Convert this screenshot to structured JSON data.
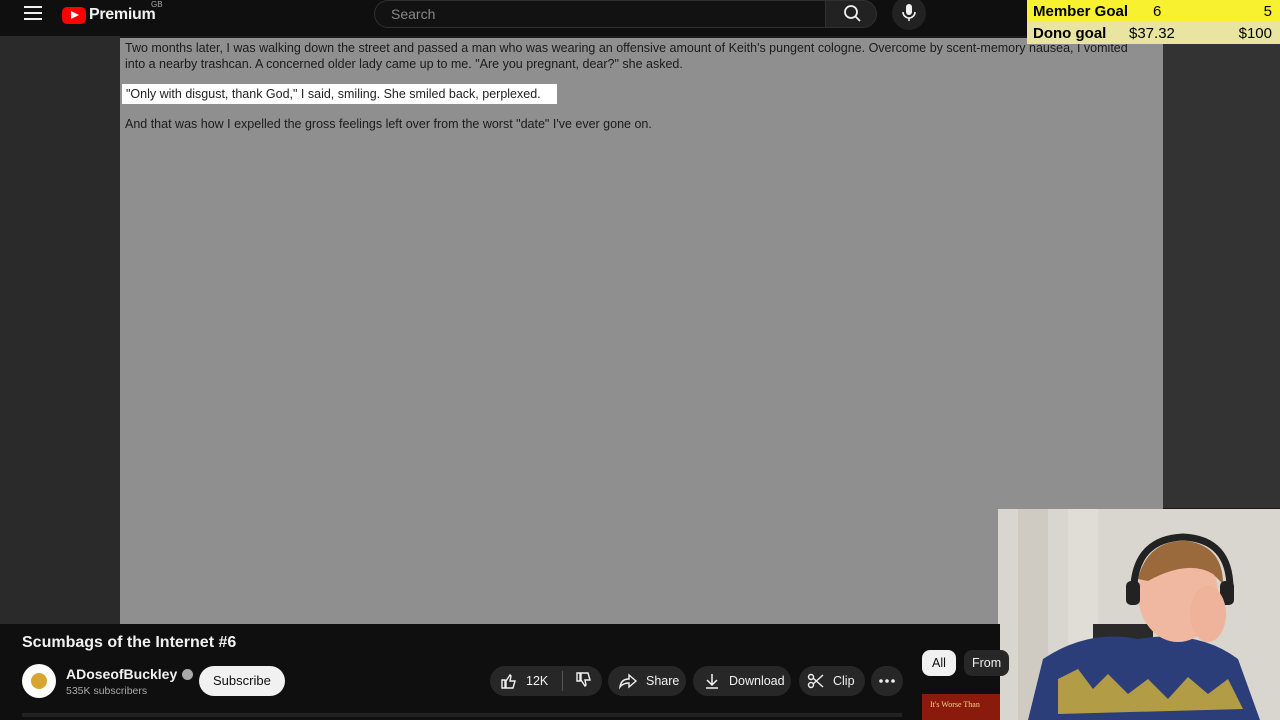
{
  "header": {
    "logo_text": "Premium",
    "country_code": "GB",
    "search_placeholder": "Search",
    "icons": [
      "menu-icon",
      "youtube-logo-icon",
      "search-icon",
      "mic-icon"
    ]
  },
  "stream_overlay": {
    "member_goal_label": "Member Goal",
    "member_goal_current": "6",
    "member_goal_target": "5",
    "dono_goal_label": "Dono goal",
    "dono_goal_current": "$37.32",
    "dono_goal_target": "$100",
    "colors": {
      "member": "#f7f130",
      "dono": "#ece9c4"
    }
  },
  "document": {
    "paragraph_1": "Two months later, I was walking down the street and passed a man who was wearing an offensive amount of Keith's pungent cologne. Overcome by scent-memory nausea, I vomited into a nearby trashcan. A concerned older lady came up to me. \"Are you pregnant, dear?\" she asked.",
    "paragraph_2": "\"Only with disgust, thank God,\" I said, smiling. She smiled back, perplexed.",
    "paragraph_3": "And that was how I expelled the gross feelings left over from the worst \"date\" I've ever gone on."
  },
  "video_info": {
    "title": "Scumbags of the Internet #6",
    "channel_name": "ADoseofBuckley",
    "subscriber_count": "535K subscribers",
    "subscribe_label": "Subscribe",
    "like_count": "12K",
    "share_label": "Share",
    "download_label": "Download",
    "clip_label": "Clip"
  },
  "sidebar_chips": {
    "all_label": "All",
    "from_label": "From",
    "thumbnail_text": "It's Worse Than"
  }
}
